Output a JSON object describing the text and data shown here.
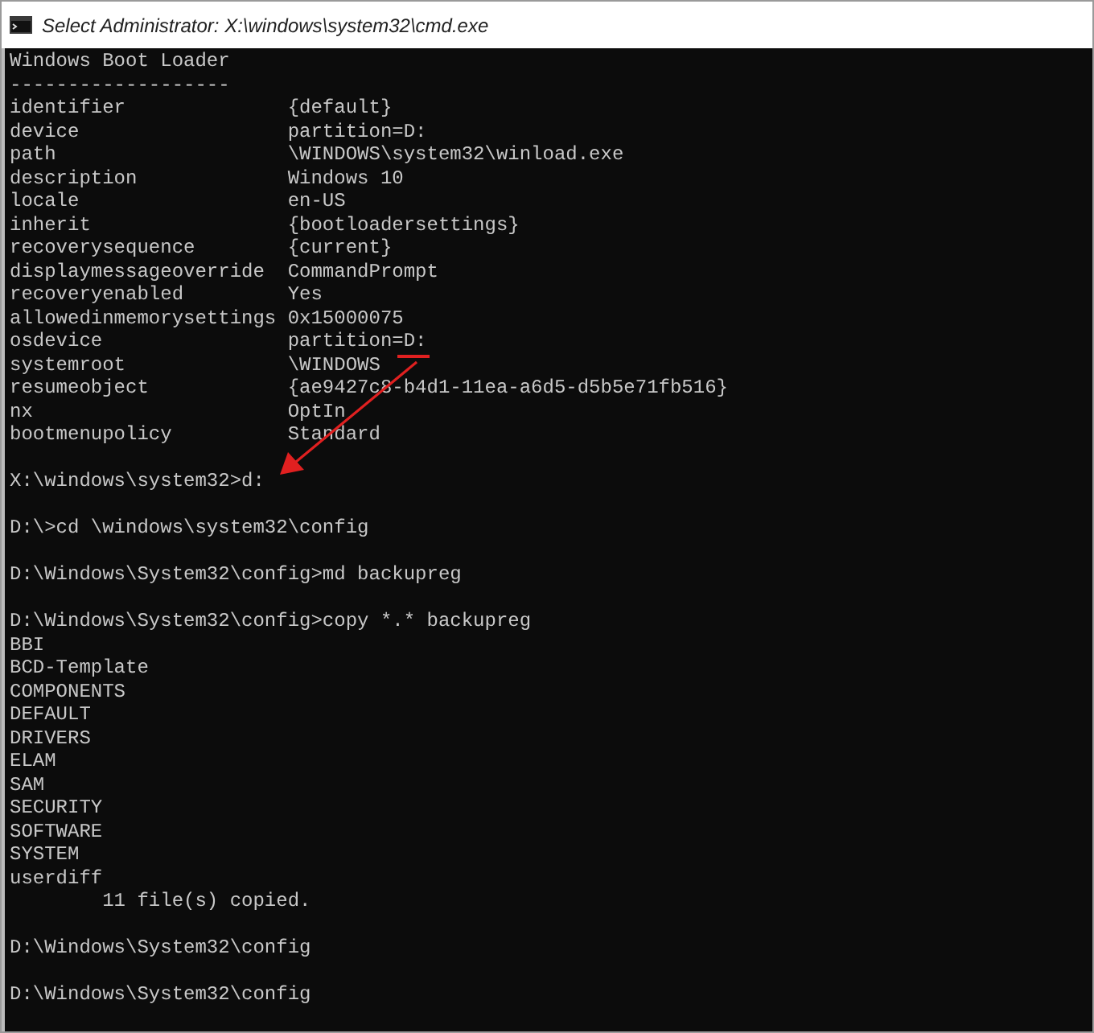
{
  "window": {
    "title": "Select Administrator: X:\\windows\\system32\\cmd.exe"
  },
  "boot_loader": {
    "heading": "Windows Boot Loader",
    "separator": "-------------------",
    "entries": [
      {
        "name": "identifier",
        "value": "{default}"
      },
      {
        "name": "device",
        "value": "partition=D:"
      },
      {
        "name": "path",
        "value": "\\WINDOWS\\system32\\winload.exe"
      },
      {
        "name": "description",
        "value": "Windows 10"
      },
      {
        "name": "locale",
        "value": "en-US"
      },
      {
        "name": "inherit",
        "value": "{bootloadersettings}"
      },
      {
        "name": "recoverysequence",
        "value": "{current}"
      },
      {
        "name": "displaymessageoverride",
        "value": "CommandPrompt"
      },
      {
        "name": "recoveryenabled",
        "value": "Yes"
      },
      {
        "name": "allowedinmemorysettings",
        "value": "0x15000075"
      },
      {
        "name": "osdevice",
        "value": "partition=D:"
      },
      {
        "name": "systemroot",
        "value": "\\WINDOWS"
      },
      {
        "name": "resumeobject",
        "value": "{ae9427c8-b4d1-11ea-a6d5-d5b5e71fb516}"
      },
      {
        "name": "nx",
        "value": "OptIn"
      },
      {
        "name": "bootmenupolicy",
        "value": "Standard"
      }
    ]
  },
  "session": [
    {
      "command_line": "X:\\windows\\system32>d:"
    },
    {
      "command_line": "D:\\>cd \\windows\\system32\\config"
    },
    {
      "command_line": "D:\\Windows\\System32\\config>md backupreg"
    },
    {
      "command_line": "D:\\Windows\\System32\\config>copy *.* backupreg",
      "output": [
        "BBI",
        "BCD-Template",
        "COMPONENTS",
        "DEFAULT",
        "DRIVERS",
        "ELAM",
        "SAM",
        "SECURITY",
        "SOFTWARE",
        "SYSTEM",
        "userdiff",
        "        11 file(s) copied."
      ]
    },
    {
      "command_line": "D:\\Windows\\System32\\config"
    },
    {
      "command_line": "D:\\Windows\\System32\\config"
    }
  ]
}
